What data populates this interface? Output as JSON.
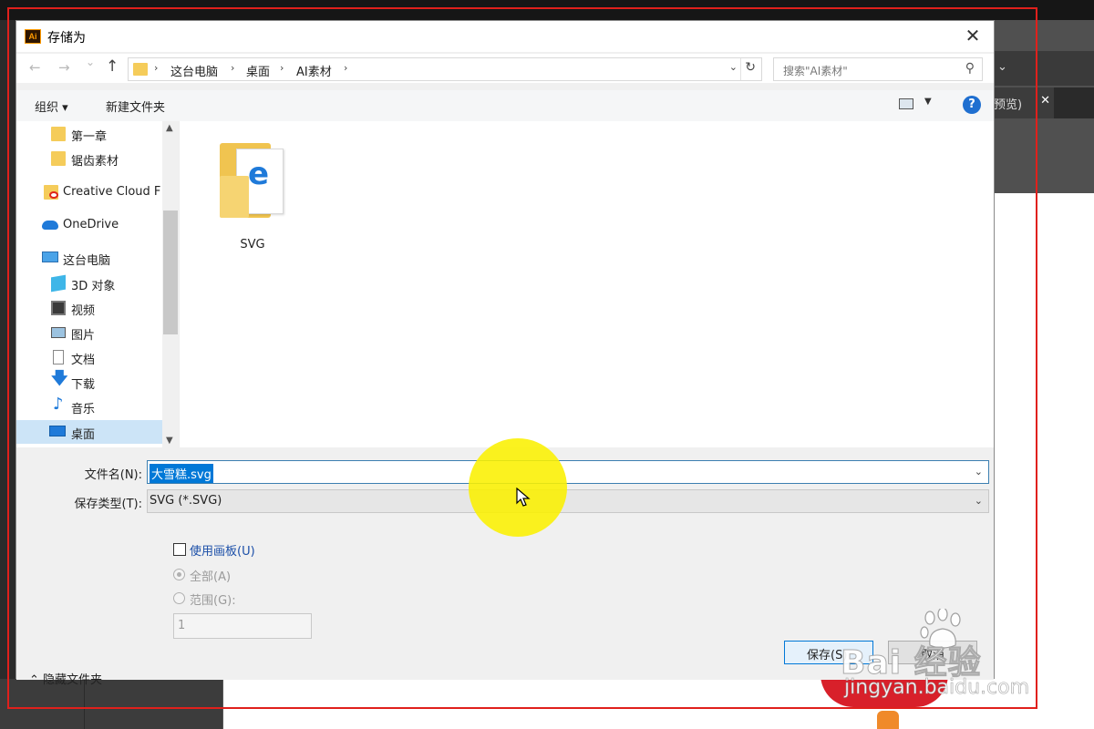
{
  "dialog": {
    "title": "存储为",
    "app_icon_text": "Ai",
    "close_glyph": "✕"
  },
  "navbar": {
    "back": "←",
    "forward": "→",
    "recent": "⌄",
    "up": "↑",
    "breadcrumbs": [
      "这台电脑",
      "桌面",
      "AI素材"
    ],
    "search_placeholder": "搜索\"AI素材\""
  },
  "toolbar": {
    "organize": "组织 ▾",
    "new_folder": "新建文件夹"
  },
  "sidebar": {
    "items": [
      {
        "label": "第一章",
        "icon": "folder-icon"
      },
      {
        "label": "锯齿素材",
        "icon": "folder-icon"
      },
      {
        "label": "Creative Cloud F",
        "icon": "creative-cloud-icon"
      },
      {
        "label": "OneDrive",
        "icon": "onedrive-icon"
      },
      {
        "label": "这台电脑",
        "icon": "computer-icon"
      },
      {
        "label": "3D 对象",
        "icon": "3d-objects-icon"
      },
      {
        "label": "视频",
        "icon": "video-icon"
      },
      {
        "label": "图片",
        "icon": "pictures-icon"
      },
      {
        "label": "文档",
        "icon": "documents-icon"
      },
      {
        "label": "下载",
        "icon": "download-icon"
      },
      {
        "label": "音乐",
        "icon": "music-icon"
      },
      {
        "label": "桌面",
        "icon": "desktop-icon",
        "selected": true
      }
    ]
  },
  "files": [
    {
      "name": "SVG",
      "icon": "folder-edge-icon"
    }
  ],
  "form": {
    "filename_label": "文件名(N):",
    "filename_value": "大雪糕.svg",
    "filetype_label": "保存类型(T):",
    "filetype_value": "SVG (*.SVG)",
    "use_artboards": "使用画板(U)",
    "all_label": "全部(A)",
    "range_label": "范围(G):",
    "range_value": "1"
  },
  "footer": {
    "hide_folders": "隐藏文件夹",
    "save": "保存(S)",
    "cancel": "取消"
  },
  "background": {
    "tab_fragment": "预览)",
    "tab_close": "✕"
  },
  "watermark": {
    "brand": "Bai  经验",
    "url": "jingyan.baidu.com"
  },
  "colors": {
    "accent": "#0078d7",
    "highlight": "#faf000",
    "frame": "#e0201c"
  }
}
